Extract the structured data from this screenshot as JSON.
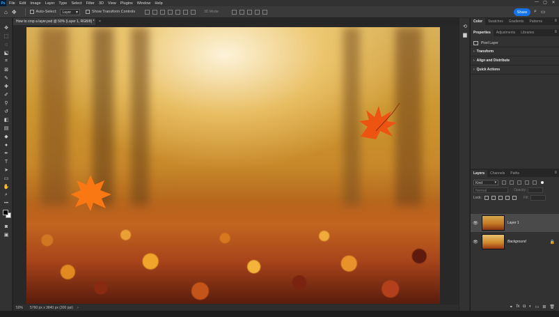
{
  "app": {
    "logo": "Ps",
    "menu": [
      "File",
      "Edit",
      "Image",
      "Layer",
      "Type",
      "Select",
      "Filter",
      "3D",
      "View",
      "Plugins",
      "Window",
      "Help"
    ],
    "window_controls": [
      "—",
      "▢",
      "✕"
    ]
  },
  "options_bar": {
    "auto_select_label": "Auto-Select:",
    "auto_select_target": "Layer",
    "show_transform_label": "Show Transform Controls",
    "mode_3d_label": "3D Mode:",
    "share_label": "Share",
    "icons": [
      "search-icon",
      "workspace-icon"
    ]
  },
  "document": {
    "tab_title": "How to crop a layer.psd @ 50% (Layer 1, RGB/8) *",
    "tab_close": "×"
  },
  "status_bar": {
    "zoom": "50%",
    "doc_info": "5760 px x 3840 px (300 ppi)",
    "arrow": "›"
  },
  "panels": {
    "top_tabs": [
      "Color",
      "Swatches",
      "Gradients",
      "Patterns"
    ],
    "props_tabs": [
      "Properties",
      "Adjustments",
      "Libraries"
    ],
    "props_kind": "Pixel Layer",
    "props_sections": [
      "Transform",
      "Align and Distribute",
      "Quick Actions"
    ],
    "layers_tabs": [
      "Layers",
      "Channels",
      "Paths"
    ],
    "kind_filter": "Kind",
    "blend_mode": "Normal",
    "opacity_label": "Opacity:",
    "lock_label": "Lock:",
    "fill_label": "Fill:",
    "layers": [
      {
        "name": "Layer 1",
        "selected": true,
        "locked": false
      },
      {
        "name": "Background",
        "selected": false,
        "locked": true
      }
    ],
    "footer_icons": [
      "link-icon",
      "fx-icon",
      "mask-icon",
      "adjustment-icon",
      "folder-icon",
      "new-layer-icon",
      "trash-icon"
    ],
    "menu_glyph": "≡"
  },
  "colors": {
    "accent": "#1473e6",
    "foreground": "#000000",
    "background": "#ffffff"
  }
}
